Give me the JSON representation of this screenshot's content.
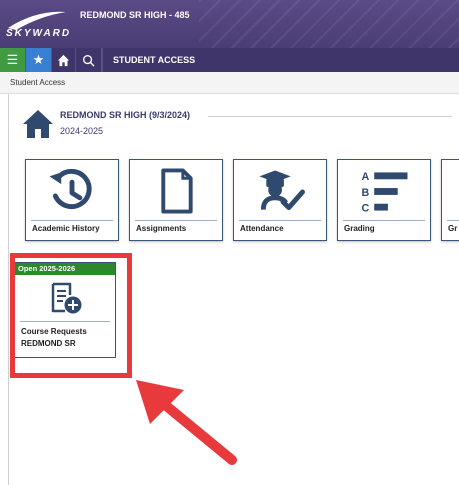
{
  "header": {
    "brand": "SKYWARD",
    "school_title": "REDMOND SR HIGH - 485"
  },
  "nav": {
    "page_title": "STUDENT ACCESS",
    "icons": [
      "menu-icon",
      "star-icon",
      "home-icon",
      "search-icon"
    ]
  },
  "breadcrumb": "Student Access",
  "school": {
    "name": "REDMOND SR HIGH (9/3/2024)",
    "year": "2024-2025"
  },
  "tiles": [
    {
      "label": "Academic History",
      "icon": "history-icon"
    },
    {
      "label": "Assignments",
      "icon": "document-icon"
    },
    {
      "label": "Attendance",
      "icon": "graduate-check-icon"
    },
    {
      "label": "Grading",
      "icon": "grades-abc-icon"
    },
    {
      "label": "Gr",
      "icon": ""
    }
  ],
  "grading_letters": [
    "A",
    "B",
    "C"
  ],
  "course_requests": {
    "banner": "Open 2025-2026",
    "label_line1": "Course Requests",
    "label_line2": "REDMOND SR",
    "icon": "course-request-add-icon"
  },
  "colors": {
    "header_purple": "#4a3d74",
    "menu_green": "#3f9a42",
    "star_blue": "#3a80d2",
    "tile_border": "#3b5577",
    "icon_navy": "#2f4a6e",
    "banner_green": "#2a8a2a",
    "highlight_red": "#e8393d"
  }
}
